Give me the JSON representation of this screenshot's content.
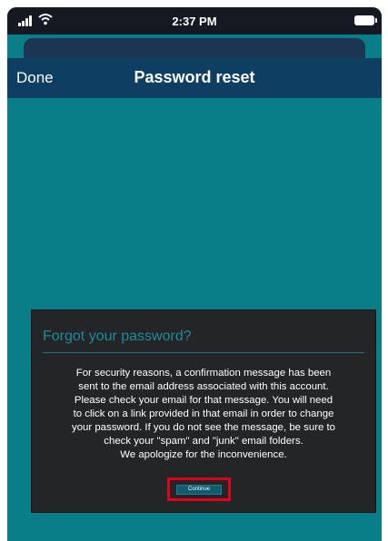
{
  "status_bar": {
    "time": "2:37 PM",
    "signal_icon": "cellular-signal-icon",
    "wifi_icon": "wifi-icon",
    "battery_icon": "battery-icon"
  },
  "nav": {
    "done_label": "Done",
    "title": "Password reset"
  },
  "dialog": {
    "title": "Forgot your password?",
    "message_lines": [
      "For security reasons, a confirmation message has been",
      "sent to the email address associated with this account.",
      "Please check your email for that message. You will need",
      "to click on a link provided in that email in order to change",
      "your password. If you do not see the message, be sure to",
      "check your \"spam\" and \"junk\" email folders.",
      "We apologize for the inconvenience."
    ],
    "continue_label": "Continue"
  },
  "colors": {
    "background": "#0a7e88",
    "navbar": "#0e3f63",
    "dialog": "#232526",
    "dialog_title": "#1b8c9a",
    "highlight": "#e0001a"
  }
}
